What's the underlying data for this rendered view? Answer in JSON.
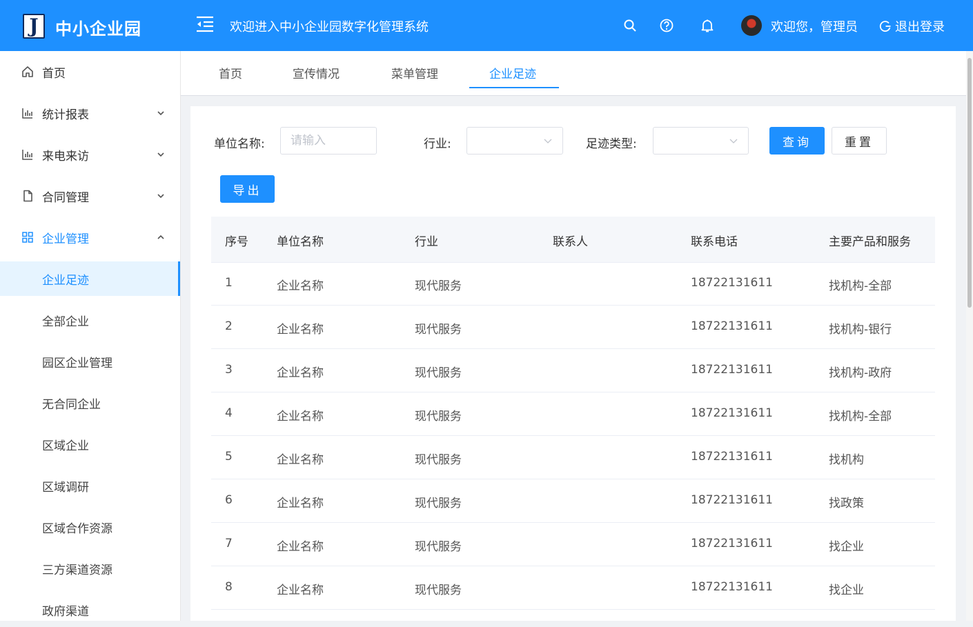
{
  "header": {
    "logo_letter": "J",
    "logo_text": "中小企业园",
    "title": "欢迎进入中小企业园数字化管理系统",
    "welcome": "欢迎您，管理员",
    "logout": "退出登录"
  },
  "sidebar": {
    "items": [
      {
        "label": "首页",
        "icon": "home-icon"
      },
      {
        "label": "统计报表",
        "icon": "bar-chart-icon"
      },
      {
        "label": "来电来访",
        "icon": "bar-chart-icon"
      },
      {
        "label": "合同管理",
        "icon": "document-icon"
      },
      {
        "label": "企业管理",
        "icon": "grid-icon"
      }
    ],
    "sub_items": [
      {
        "label": "企业足迹"
      },
      {
        "label": "全部企业"
      },
      {
        "label": "园区企业管理"
      },
      {
        "label": "无合同企业"
      },
      {
        "label": "区域企业"
      },
      {
        "label": "区域调研"
      },
      {
        "label": "区域合作资源"
      },
      {
        "label": "三方渠道资源"
      },
      {
        "label": "政府渠道"
      }
    ]
  },
  "tabs": [
    {
      "label": "首页"
    },
    {
      "label": "宣传情况"
    },
    {
      "label": "菜单管理"
    },
    {
      "label": "企业足迹"
    }
  ],
  "filters": {
    "name_label": "单位名称:",
    "name_placeholder": "请输入",
    "industry_label": "行业:",
    "type_label": "足迹类型:",
    "query_button": "查询",
    "reset_button": "重置",
    "export_button": "导出"
  },
  "table": {
    "headers": [
      "序号",
      "单位名称",
      "行业",
      "联系人",
      "联系电话",
      "主要产品和服务"
    ],
    "rows": [
      [
        "1",
        "企业名称",
        "现代服务",
        "",
        "18722131611",
        "找机构-全部"
      ],
      [
        "2",
        "企业名称",
        "现代服务",
        "",
        "18722131611",
        "找机构-银行"
      ],
      [
        "3",
        "企业名称",
        "现代服务",
        "",
        "18722131611",
        "找机构-政府"
      ],
      [
        "4",
        "企业名称",
        "现代服务",
        "",
        "18722131611",
        "找机构-全部"
      ],
      [
        "5",
        "企业名称",
        "现代服务",
        "",
        "18722131611",
        "找机构"
      ],
      [
        "6",
        "企业名称",
        "现代服务",
        "",
        "18722131611",
        "找政策"
      ],
      [
        "7",
        "企业名称",
        "现代服务",
        "",
        "18722131611",
        "找企业"
      ],
      [
        "8",
        "企业名称",
        "现代服务",
        "",
        "18722131611",
        "找企业"
      ]
    ]
  },
  "colors": {
    "primary": "#1e90ff",
    "header_bg": "#1e90ff",
    "selected_bg": "#e6f4ff"
  }
}
